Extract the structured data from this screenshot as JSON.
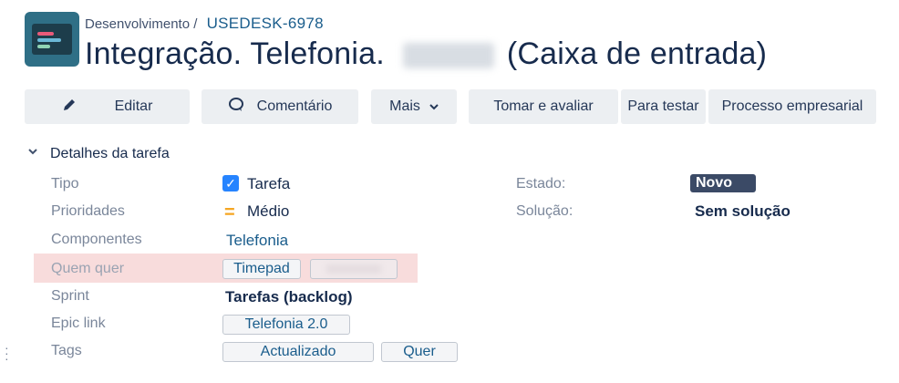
{
  "breadcrumb": {
    "project": "Desenvolvimento /",
    "issue_key": "USEDESK-6978"
  },
  "title": {
    "main": "Integração.  Telefonia.",
    "suffix": "(Caixa de entrada)"
  },
  "toolbar": {
    "edit": "Editar",
    "comment": "Comentário",
    "more": "Mais",
    "take_evaluate": "Tomar e avaliar",
    "to_test": "Para testar",
    "business_process": "Processo empresarial"
  },
  "details": {
    "section_title": "Detalhes da tarefa",
    "fields": {
      "type": {
        "label": "Tipo",
        "value": "Tarefa"
      },
      "priority": {
        "label": "Prioridades",
        "value": "Médio"
      },
      "components": {
        "label": "Componentes",
        "value": "Telefonia"
      },
      "who_wants": {
        "label": "Quem quer",
        "value": "Timepad"
      },
      "sprint": {
        "label": "Sprint",
        "value": "Tarefas (backlog)"
      },
      "epic_link": {
        "label": "Epic link",
        "value": "Telefonia 2.0"
      },
      "tags": {
        "label": "Tags",
        "values": [
          "Actualizado",
          "Quer"
        ]
      }
    },
    "right": {
      "status": {
        "label": "Estado:",
        "value": "Novo"
      },
      "resolution": {
        "label": "Solução:",
        "value": "Sem solução"
      }
    }
  },
  "colors": {
    "accent": "#1a5d8c",
    "status_bg": "#3b4a66",
    "highlight": "#f8dcdc",
    "priority": "#f5a623",
    "checkbox": "#2684ff"
  },
  "icons": [
    "project-icon",
    "pencil-icon",
    "comment-icon",
    "chevron-down-icon",
    "checkbox-icon",
    "priority-medium-icon"
  ]
}
